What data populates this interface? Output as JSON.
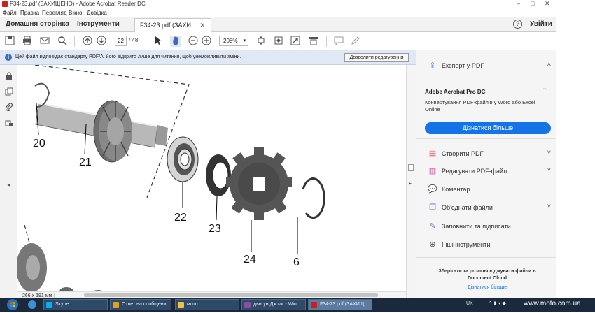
{
  "window": {
    "title": "F34-23.pdf (ЗАХИЩЕНО) - Adobe Acrobat Reader DC"
  },
  "menu": [
    "Файл",
    "Правка",
    "Перегляд",
    "Вікно",
    "Довідка"
  ],
  "tabs": {
    "home": "Домашня сторінка",
    "tools": "Інструменти",
    "document": "F34-23.pdf (ЗАХИ...",
    "login": "Увійти"
  },
  "toolbar": {
    "page_current": "22",
    "page_total": "/ 48",
    "zoom": "208%"
  },
  "infobar": {
    "message": "Цей файл відповідає стандарту PDF/A; його відкрито лише для читання, щоб унеможливити зміни.",
    "button": "Дозволити редагування"
  },
  "document": {
    "part_numbers": [
      "20",
      "21",
      "22",
      "23",
      "24",
      "6"
    ],
    "page_size": "266 x 191 мм"
  },
  "right_panel": {
    "export_title": "Експорт у PDF",
    "promo_title": "Adobe Acrobat Pro DC",
    "promo_desc": "Конвертування PDF-файлів у Word або Excel Online",
    "promo_button": "Дізнатися більше",
    "tools": [
      {
        "label": "Створити PDF",
        "icon": "create-pdf-icon",
        "color": "#e0474c"
      },
      {
        "label": "Редагувати PDF-файл",
        "icon": "edit-pdf-icon",
        "color": "#d4479a"
      },
      {
        "label": "Коментар",
        "icon": "comment-icon",
        "color": "#f0b400"
      },
      {
        "label": "Об'єднати файли",
        "icon": "combine-files-icon",
        "color": "#3a7ad1"
      },
      {
        "label": "Заповнити та підписати",
        "icon": "fill-sign-icon",
        "color": "#7a5ed3"
      },
      {
        "label": "Інші інструменти",
        "icon": "more-tools-icon",
        "color": "#555555"
      }
    ],
    "cloud_text": "Зберігати та розповсюджувати файли в Document Cloud",
    "cloud_link": "Дізнатися більше"
  },
  "taskbar": {
    "items": [
      {
        "label": "Skype",
        "color": "#00aff0"
      },
      {
        "label": "Ответ на сообщени...",
        "color": "#e0a020"
      },
      {
        "label": "мото",
        "color": "#f0c040"
      },
      {
        "label": "двигун Дж.rar - Win...",
        "color": "#8a4fa0"
      },
      {
        "label": "F34-23.pdf (ЗАХИЩ...",
        "color": "#c8201e"
      }
    ],
    "lang": "UK",
    "watermark": "www.moto.com.ua"
  },
  "colors": {
    "accent": "#1473e6",
    "infobar": "#dfe8f4"
  }
}
